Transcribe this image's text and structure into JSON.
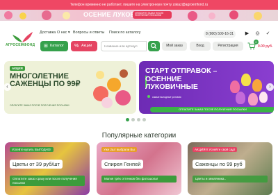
{
  "topbar": {
    "text": "Телефон временно не работает, пишите на электронную почту zakaz@agroemfond.ru"
  },
  "promo": {
    "title": "ОСЕНИЕ ЛУКОВИЧНЫЕ",
    "pill": "ОПЛАТИТЕ ЗАКАЗ ПОСЛЕ ПОЛУЧЕНИЯ ПОСЫЛКИ"
  },
  "logo": {
    "text": "АГРОСЕМФОНД"
  },
  "nav": {
    "delivery": "Доставка",
    "about": "О нас",
    "faq": "Вопросы и ответы",
    "search_catalog": "Поиск по каталогу"
  },
  "phone": "8 (800) 500-16-31",
  "toolbar": {
    "catalog": "Каталог",
    "sales": "Акции",
    "search_placeholder": "Название или артикул",
    "my_order": "Мой заказ",
    "login": "Вход",
    "register": "Регистрация"
  },
  "cart": {
    "count": "0",
    "price": "0.00 руб."
  },
  "banner1": {
    "tag": "АКЦИЯ",
    "title": "МНОГОЛЕТНИЕ САЖЕНЦЫ ПО 99₽",
    "pill": "ОПЛАТИТЕ ЗАКАЗ ПОСЛЕ ПОЛУЧЕНИЯ ПОСЫЛКИ"
  },
  "banner2": {
    "title": "СТАРТ ОТПРАВОК – ОСЕННИЕ ЛУКОВИЧНЫЕ",
    "badge": "самые выгодные условия",
    "pill": "ОПЛАТИТЕ ЗАКАЗ ПОСЛЕ ПОЛУЧЕНИЯ ПОСЫЛКИ"
  },
  "section": {
    "title": "Популярные категории"
  },
  "cards": [
    {
      "tag": "Успейте купить ВЫГОДНО!",
      "title": "Цветы от 39 руб/шт",
      "note": "Оплатите заказ сразу или после получения посылки"
    },
    {
      "tag": "Уже 2шт выбрали Вы",
      "title": "Спирея Генпей",
      "note": "Магия трёх оттенков без фотошопа!"
    },
    {
      "tag": "АКЦИЯ!!! Успейте свой сад!",
      "title": "Саженцы по 99 руб",
      "note": "Цветы и земляника.."
    }
  ],
  "colors": {
    "green": "#36a14c",
    "red": "#e54462",
    "purple": "#7a35c4",
    "topbar": "#ef4764"
  }
}
